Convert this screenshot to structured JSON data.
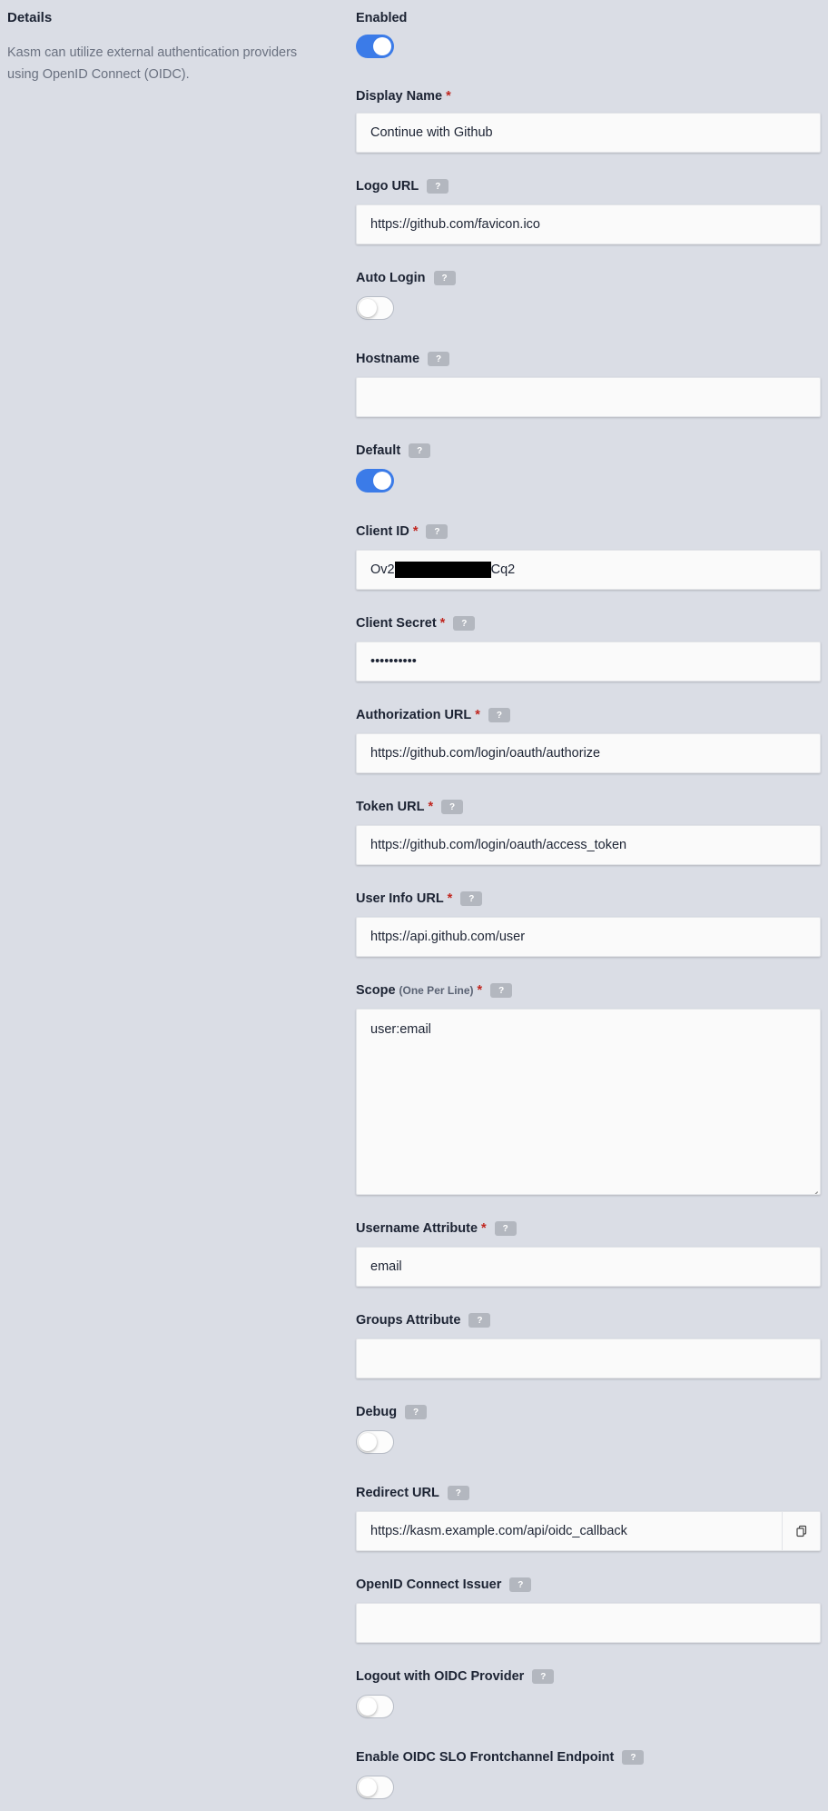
{
  "details": {
    "title": "Details",
    "description": "Kasm can utilize external authentication providers using OpenID Connect (OIDC)."
  },
  "form": {
    "enabled": {
      "label": "Enabled",
      "value": true
    },
    "display_name": {
      "label": "Display Name",
      "required": "*",
      "value": "Continue with Github"
    },
    "logo_url": {
      "label": "Logo URL",
      "help": "?",
      "value": "https://github.com/favicon.ico"
    },
    "auto_login": {
      "label": "Auto Login",
      "help": "?",
      "value": false
    },
    "hostname": {
      "label": "Hostname",
      "help": "?",
      "value": ""
    },
    "default": {
      "label": "Default",
      "help": "?",
      "value": true
    },
    "client_id": {
      "label": "Client ID",
      "required": "*",
      "help": "?",
      "value_prefix": "Ov2",
      "value_suffix": "Cq2"
    },
    "client_secret": {
      "label": "Client Secret",
      "required": "*",
      "help": "?",
      "value": "••••••••••"
    },
    "authorization_url": {
      "label": "Authorization URL",
      "required": "*",
      "help": "?",
      "value": "https://github.com/login/oauth/authorize"
    },
    "token_url": {
      "label": "Token URL",
      "required": "*",
      "help": "?",
      "value": "https://github.com/login/oauth/access_token"
    },
    "user_info_url": {
      "label": "User Info URL",
      "required": "*",
      "help": "?",
      "value": "https://api.github.com/user"
    },
    "scope": {
      "label": "Scope",
      "sublabel": "(One Per Line)",
      "required": "*",
      "help": "?",
      "value": "user:email"
    },
    "username_attribute": {
      "label": "Username Attribute",
      "required": "*",
      "help": "?",
      "value": "email"
    },
    "groups_attribute": {
      "label": "Groups Attribute",
      "help": "?",
      "value": ""
    },
    "debug": {
      "label": "Debug",
      "help": "?",
      "value": false
    },
    "redirect_url": {
      "label": "Redirect URL",
      "help": "?",
      "value": "https://kasm.example.com/api/oidc_callback"
    },
    "oidc_issuer": {
      "label": "OpenID Connect Issuer",
      "help": "?",
      "value": ""
    },
    "logout_with_provider": {
      "label": "Logout with OIDC Provider",
      "help": "?",
      "value": false
    },
    "slo_frontchannel": {
      "label": "Enable OIDC SLO Frontchannel Endpoint",
      "help": "?",
      "value": false
    }
  },
  "colors": {
    "accent": "#3b7be8",
    "required": "#c0261f",
    "background": "#dadde5"
  },
  "icons": {
    "help": "question-badge",
    "copy": "copy-icon"
  }
}
